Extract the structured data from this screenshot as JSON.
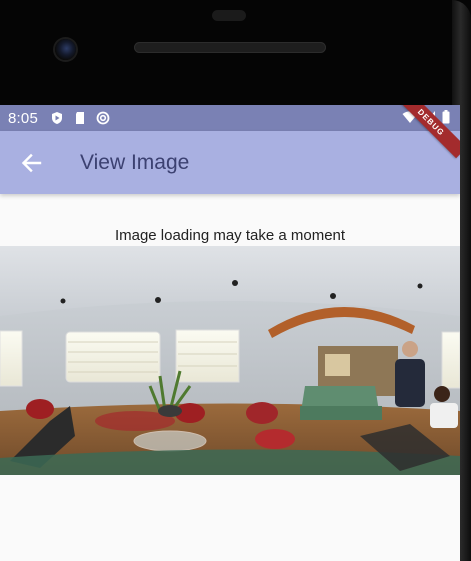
{
  "status_bar": {
    "time": "8:05",
    "icons_left": [
      "shield-icon",
      "sd-card-icon",
      "sync-icon"
    ],
    "icons_right": [
      "wifi-icon",
      "signal-icon",
      "battery-icon"
    ],
    "debug_label": "DEBUG"
  },
  "app_bar": {
    "title": "View Image",
    "back_icon": "arrow-back-icon",
    "background": "#a9b0e1",
    "title_color": "#3c4171"
  },
  "main": {
    "caption": "Image loading may take a moment",
    "image_description": "360 panorama of a living room"
  },
  "colors": {
    "status_bar": "#7a81b4",
    "screen_background": "#fafafa",
    "debug_ribbon": "#a32b2d"
  }
}
